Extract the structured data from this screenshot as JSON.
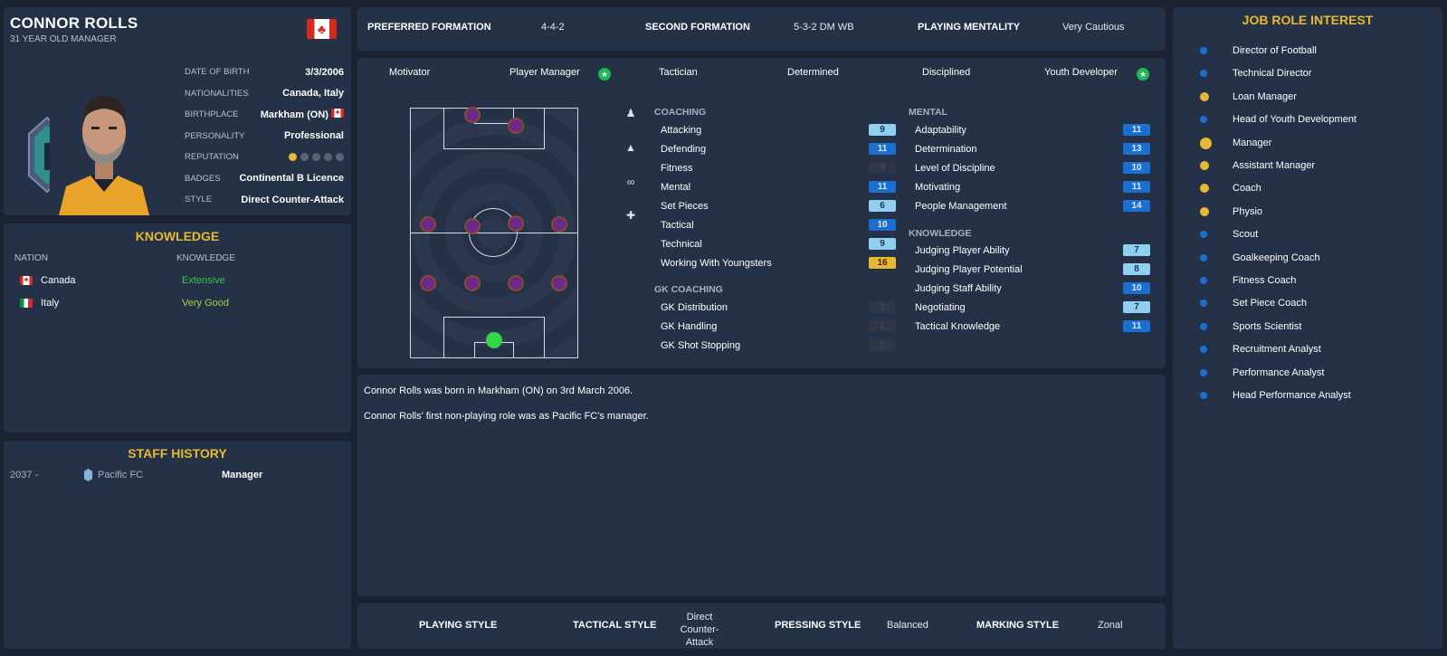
{
  "profile": {
    "name": "CONNOR ROLLS",
    "subtitle": "31 YEAR OLD MANAGER",
    "info": [
      {
        "key": "DATE OF BIRTH",
        "value": "3/3/2006"
      },
      {
        "key": "NATIONALITIES",
        "value": "Canada, Italy"
      },
      {
        "key": "BIRTHPLACE",
        "value": "Markham (ON)"
      },
      {
        "key": "PERSONALITY",
        "value": "Professional"
      },
      {
        "key": "REPUTATION",
        "value": ""
      },
      {
        "key": "BADGES",
        "value": "Continental B Licence"
      },
      {
        "key": "STYLE",
        "value": "Direct Counter-Attack"
      }
    ],
    "reputation_stars": 1,
    "reputation_max": 5
  },
  "knowledge": {
    "title": "KNOWLEDGE",
    "col_nation": "NATION",
    "col_knowledge": "KNOWLEDGE",
    "rows": [
      {
        "nation": "Canada",
        "level": "Extensive",
        "color": "#35c84a"
      },
      {
        "nation": "Italy",
        "level": "Very Good",
        "color": "#9fd34a"
      }
    ]
  },
  "history": {
    "title": "STAFF HISTORY",
    "rows": [
      {
        "years": "2037 -",
        "club": "Pacific FC",
        "role": "Manager"
      }
    ]
  },
  "formation": {
    "preferred_label": "PREFERRED FORMATION",
    "preferred": "4-4-2",
    "second_label": "SECOND FORMATION",
    "second": "5-3-2 DM WB",
    "mentality_label": "PLAYING MENTALITY",
    "mentality": "Very Cautious"
  },
  "roles": [
    "Motivator",
    "Player Manager",
    "Tactician",
    "Determined",
    "Disciplined",
    "Youth Developer"
  ],
  "coaching": {
    "title": "COACHING",
    "items": [
      {
        "name": "Attacking",
        "value": "9"
      },
      {
        "name": "Defending",
        "value": "11"
      },
      {
        "name": "Fitness",
        "value": "3"
      },
      {
        "name": "Mental",
        "value": "11"
      },
      {
        "name": "Set Pieces",
        "value": "6"
      },
      {
        "name": "Tactical",
        "value": "10"
      },
      {
        "name": "Technical",
        "value": "9"
      },
      {
        "name": "Working With Youngsters",
        "value": "16"
      }
    ]
  },
  "gk_coaching": {
    "title": "GK COACHING",
    "items": [
      {
        "name": "GK Distribution",
        "value": "3"
      },
      {
        "name": "GK Handling",
        "value": "1"
      },
      {
        "name": "GK Shot Stopping",
        "value": "5"
      }
    ]
  },
  "mental": {
    "title": "MENTAL",
    "items": [
      {
        "name": "Adaptability",
        "value": "11"
      },
      {
        "name": "Determination",
        "value": "13"
      },
      {
        "name": "Level of Discipline",
        "value": "10"
      },
      {
        "name": "Motivating",
        "value": "11"
      },
      {
        "name": "People Management",
        "value": "14"
      }
    ]
  },
  "knowledge_attrs": {
    "title": "KNOWLEDGE",
    "items": [
      {
        "name": "Judging Player Ability",
        "value": "7"
      },
      {
        "name": "Judging Player Potential",
        "value": "8"
      },
      {
        "name": "Judging Staff Ability",
        "value": "10"
      },
      {
        "name": "Negotiating",
        "value": "7"
      },
      {
        "name": "Tactical Knowledge",
        "value": "11"
      }
    ]
  },
  "bio": [
    "Connor Rolls was born in Markham (ON) on 3rd March 2006.",
    "Connor Rolls' first non-playing role was as Pacific FC's manager."
  ],
  "style": {
    "playing_label": "PLAYING STYLE",
    "tactical_label": "TACTICAL STYLE",
    "tactical": "Direct Counter-Attack",
    "pressing_label": "PRESSING STYLE",
    "pressing": "Balanced",
    "marking_label": "MARKING STYLE",
    "marking": "Zonal"
  },
  "job_roles": {
    "title": "JOB ROLE INTEREST",
    "items": [
      {
        "name": "Director of Football",
        "level": "blue"
      },
      {
        "name": "Technical Director",
        "level": "blue"
      },
      {
        "name": "Loan Manager",
        "level": "gold"
      },
      {
        "name": "Head of Youth Development",
        "level": "blue"
      },
      {
        "name": "Manager",
        "level": "gold-lg"
      },
      {
        "name": "Assistant Manager",
        "level": "gold"
      },
      {
        "name": "Coach",
        "level": "gold"
      },
      {
        "name": "Physio",
        "level": "gold"
      },
      {
        "name": "Scout",
        "level": "blue"
      },
      {
        "name": "Goalkeeping Coach",
        "level": "blue"
      },
      {
        "name": "Fitness Coach",
        "level": "blue"
      },
      {
        "name": "Set Piece Coach",
        "level": "blue"
      },
      {
        "name": "Sports Scientist",
        "level": "blue"
      },
      {
        "name": "Recruitment Analyst",
        "level": "blue"
      },
      {
        "name": "Performance Analyst",
        "level": "blue"
      },
      {
        "name": "Head Performance Analyst",
        "level": "blue"
      }
    ]
  }
}
